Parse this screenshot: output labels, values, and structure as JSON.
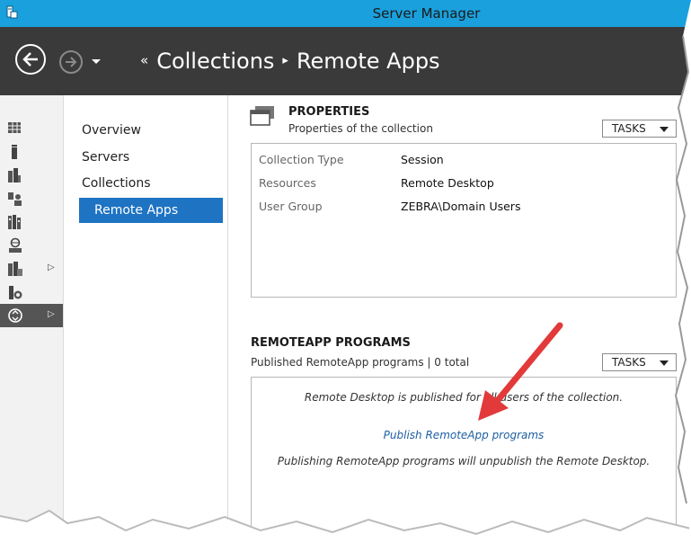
{
  "window": {
    "title": "Server Manager"
  },
  "header": {
    "breadcrumb": [
      "Collections",
      "Remote Apps"
    ],
    "breadcrumb_lead": "«",
    "breadcrumb_sep": "▸"
  },
  "subnav": {
    "items": [
      {
        "label": "Overview"
      },
      {
        "label": "Servers"
      },
      {
        "label": "Collections"
      },
      {
        "label": "Remote Apps",
        "selected": true
      }
    ]
  },
  "rail": {
    "items": [
      {
        "icon": "dashboard-icon"
      },
      {
        "icon": "local-server-icon"
      },
      {
        "icon": "all-servers-icon"
      },
      {
        "icon": "ad-ds-icon"
      },
      {
        "icon": "file-storage-icon"
      },
      {
        "icon": "iis-icon"
      },
      {
        "icon": "rds-icon",
        "expandable": true
      },
      {
        "icon": "wsus-icon"
      },
      {
        "icon": "remote-desktop-icon",
        "expandable": true,
        "active": true
      }
    ]
  },
  "properties": {
    "title": "PROPERTIES",
    "subtitle": "Properties of the collection",
    "tasks_label": "TASKS",
    "rows": [
      {
        "label": "Collection Type",
        "value": "Session"
      },
      {
        "label": "Resources",
        "value": "Remote Desktop"
      },
      {
        "label": "User Group",
        "value": "ZEBRA\\Domain Users"
      }
    ]
  },
  "remoteapp": {
    "title": "REMOTEAPP PROGRAMS",
    "subtitle": "Published RemoteApp programs | 0 total",
    "tasks_label": "TASKS",
    "message": "Remote Desktop is published for all users of the collection.",
    "publish_link": "Publish RemoteApp programs",
    "warning": "Publishing RemoteApp programs will unpublish the Remote Desktop."
  },
  "colors": {
    "titlebar": "#1aa0dc",
    "nav_header": "#3a3a3a",
    "selection": "#1e73c2",
    "link": "#1e5fa0",
    "annotation_arrow": "#e23a3a"
  }
}
